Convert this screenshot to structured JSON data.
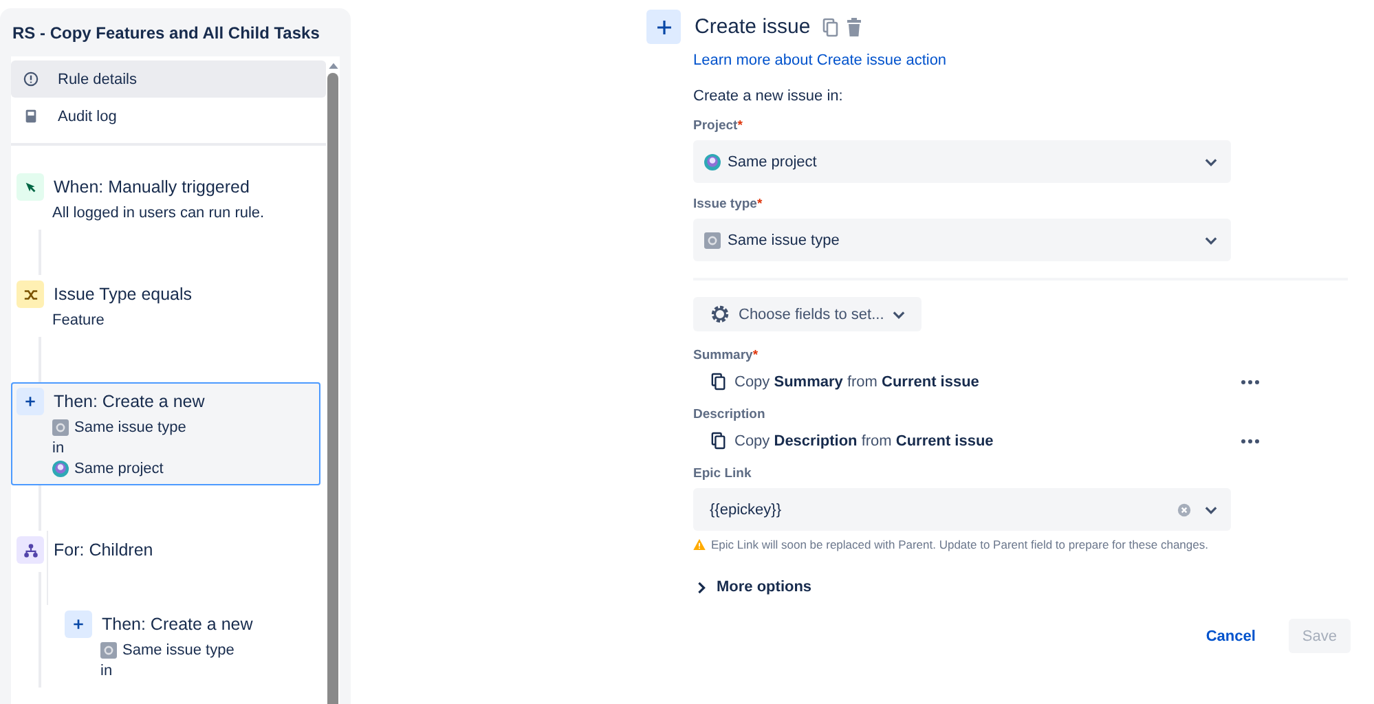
{
  "sidebar": {
    "title": "RS - Copy Features and All Child Tasks",
    "nav": [
      {
        "kind": "info",
        "label": "Rule details",
        "selected": true
      },
      {
        "kind": "log",
        "label": "Audit log",
        "selected": false
      }
    ],
    "steps": [
      {
        "kind": "trigger",
        "title": "When: Manually triggered",
        "selected": false,
        "lines": [
          {
            "kind": "plain",
            "text": "All logged in users can run rule."
          }
        ]
      },
      {
        "kind": "condition",
        "title": "Issue Type equals",
        "selected": false,
        "lines": [
          {
            "kind": "plain",
            "text": "Feature"
          }
        ]
      },
      {
        "kind": "action",
        "title": "Then: Create a new",
        "selected": true,
        "lines": [
          {
            "kind": "issue-type",
            "text": "Same issue type"
          },
          {
            "kind": "plain",
            "text": "in"
          },
          {
            "kind": "project",
            "text": "Same project"
          }
        ]
      },
      {
        "kind": "branch",
        "title": "For: Children",
        "selected": false,
        "children": [
          {
            "kind": "action",
            "title": "Then: Create a new",
            "selected": false,
            "lines": [
              {
                "kind": "issue-type",
                "text": "Same issue type"
              },
              {
                "kind": "plain",
                "text": "in"
              }
            ]
          }
        ]
      }
    ]
  },
  "panel": {
    "title": "Create issue",
    "link": "Learn more about Create issue action",
    "intro": "Create a new issue in:",
    "targets": [
      {
        "label": "Project",
        "required_mark": "*",
        "kind": "project",
        "value": "Same project"
      },
      {
        "label": "Issue type",
        "required_mark": "*",
        "kind": "issue-type",
        "value": "Same issue type"
      }
    ],
    "choose_button": "Choose fields to set...",
    "fields": [
      {
        "kind": "copy",
        "label": "Summary",
        "required_mark": "*",
        "value": "Copy **Summary** from **Current issue**"
      },
      {
        "kind": "copy",
        "label": "Description",
        "value": "Copy **Description** from **Current issue**"
      },
      {
        "kind": "select",
        "label": "Epic Link",
        "value": "{{epickey}}",
        "warning": "Epic Link will soon be replaced with Parent. Update to Parent field to prepare for these changes."
      }
    ],
    "more_options": {
      "label": "More options",
      "expanded": false
    },
    "buttons": [
      {
        "kind": "link",
        "label": "Cancel"
      },
      {
        "kind": "primary",
        "label": "Save",
        "disabled": true
      }
    ]
  }
}
